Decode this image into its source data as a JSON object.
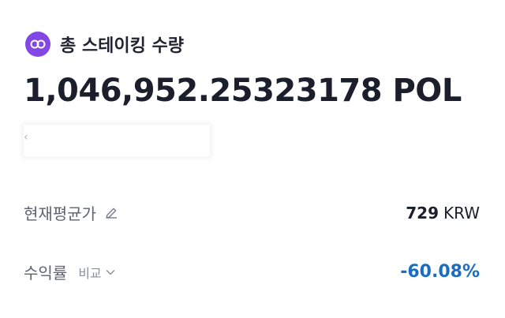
{
  "header": {
    "icon": "polygon-token-icon",
    "title": "총 스테이킹 수량"
  },
  "staking": {
    "amount": "1,046,952.25323178 POL"
  },
  "average_price": {
    "label": "현재평균가",
    "value": "729",
    "unit": "KRW",
    "edit_icon": "pencil-icon"
  },
  "return_rate": {
    "label": "수익률",
    "compare_label": "비교",
    "value": "-60.08%"
  },
  "colors": {
    "brand": "#8247e5",
    "negative_return": "#1b6dc1",
    "text_primary": "#1a1f2b",
    "text_secondary": "#5d6270"
  }
}
